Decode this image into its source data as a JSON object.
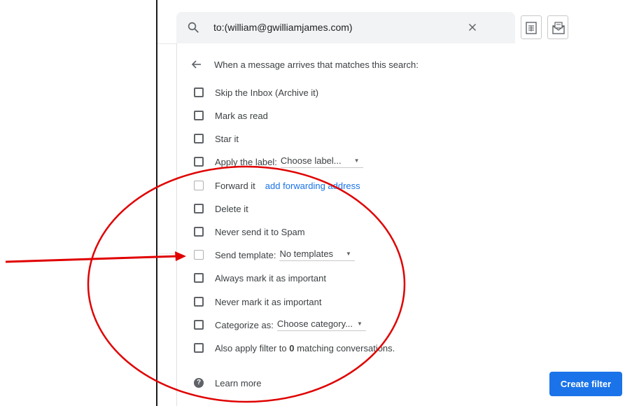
{
  "search": {
    "query": "to:(william@gwilliamjames.com)"
  },
  "toolbar": {
    "icons": [
      "spreadsheet-icon",
      "mail-icon"
    ]
  },
  "filter": {
    "heading": "When a message arrives that matches this search:",
    "options": {
      "skip_inbox": "Skip the Inbox (Archive it)",
      "mark_read": "Mark as read",
      "star": "Star it",
      "apply_label": "Apply the label:",
      "apply_label_select": "Choose label...",
      "forward": "Forward it",
      "forward_link": "add forwarding address",
      "delete": "Delete it",
      "never_spam": "Never send it to Spam",
      "send_template": "Send template:",
      "send_template_select": "No templates",
      "always_important": "Always mark it as important",
      "never_important": "Never mark it as important",
      "categorize": "Categorize as:",
      "categorize_select": "Choose category...",
      "also_apply_prefix": "Also apply filter to",
      "also_apply_count": "0",
      "also_apply_suffix": "matching conversations."
    },
    "learn_more": "Learn more",
    "create_button": "Create filter"
  },
  "colors": {
    "accent": "#1a73e8",
    "annotation": "#e00000"
  }
}
